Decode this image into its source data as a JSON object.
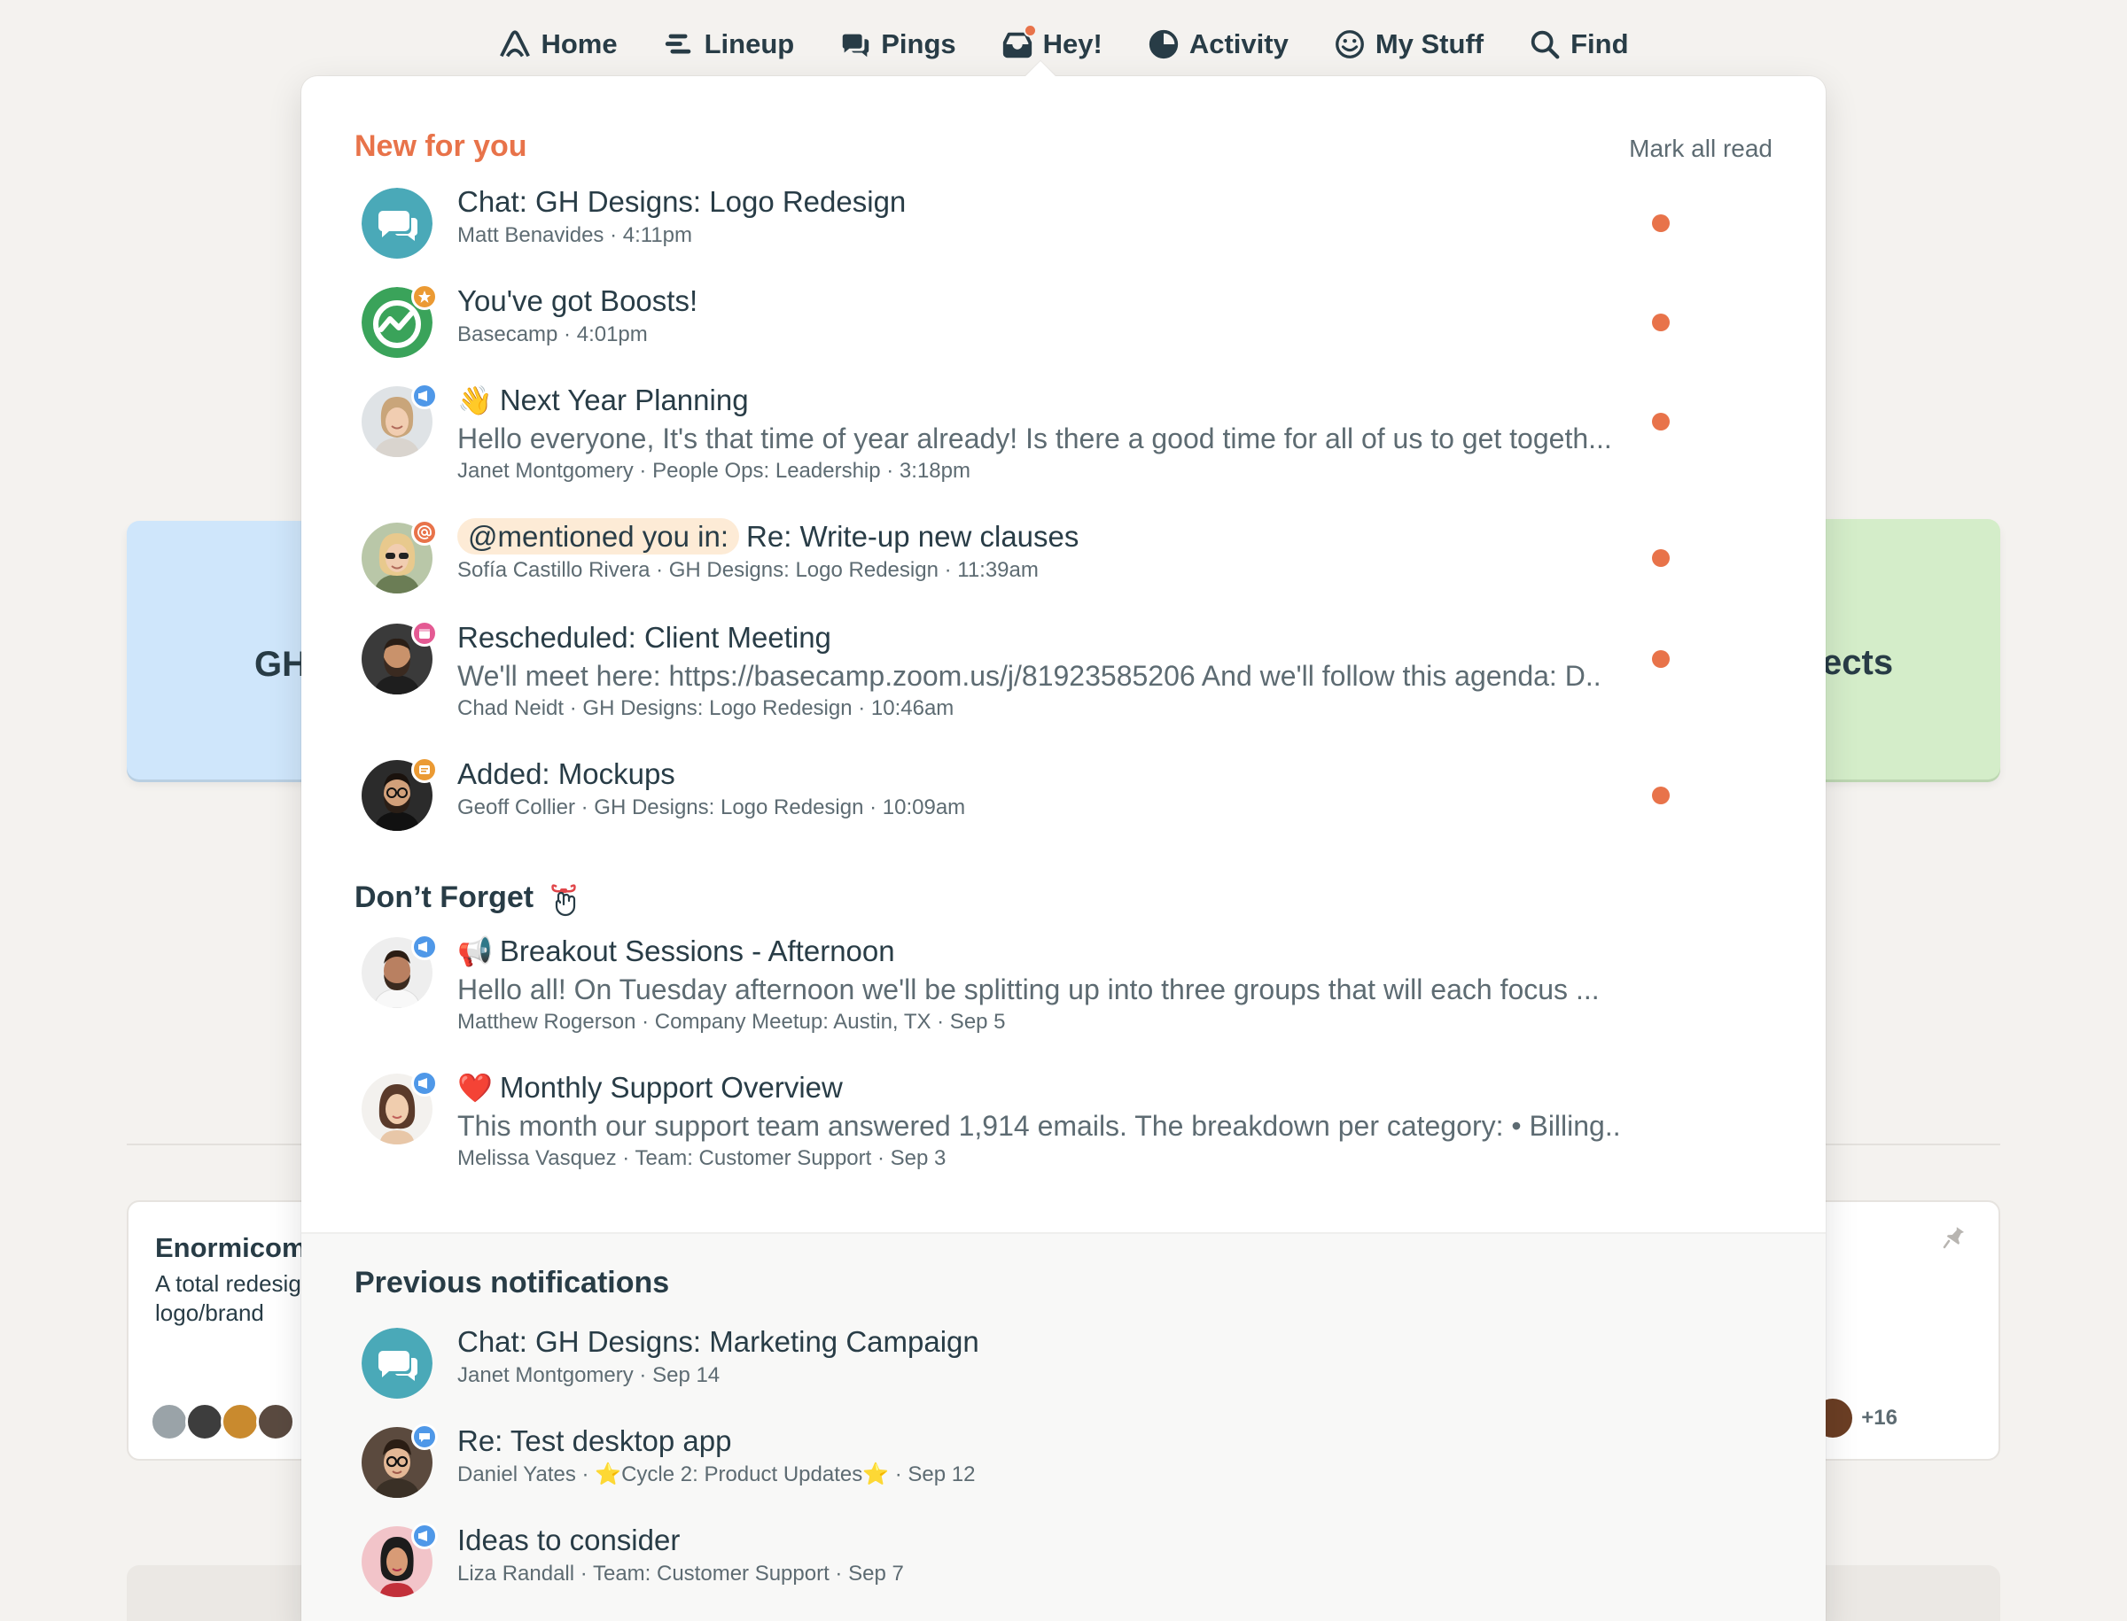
{
  "nav": [
    {
      "label": "Home",
      "icon": "home-icon"
    },
    {
      "label": "Lineup",
      "icon": "lineup-icon"
    },
    {
      "label": "Pings",
      "icon": "pings-icon"
    },
    {
      "label": "Hey!",
      "icon": "hey-icon"
    },
    {
      "label": "Activity",
      "icon": "activity-icon"
    },
    {
      "label": "My Stuff",
      "icon": "my-stuff-icon"
    },
    {
      "label": "Find",
      "icon": "search-icon"
    }
  ],
  "background": {
    "card_left_label": "GH",
    "card_right_label": "ects",
    "project_title": "Enormicom",
    "project_desc": "A total redesig logo/brand",
    "project_more": "+16"
  },
  "panel": {
    "new_heading": "New for you",
    "mark_all_read": "Mark all read",
    "new_items": [
      {
        "title": "Chat: GH Designs: Logo Redesign",
        "meta": "Matt Benavides · 4:11pm"
      },
      {
        "title": "You've got Boosts!",
        "meta": "Basecamp · 4:01pm"
      },
      {
        "emoji": "👋",
        "title": "Next Year Planning",
        "excerpt": "Hello everyone, It's that time of year already! Is there a good time for all of us to get togeth...",
        "meta": "Janet Montgomery · People Ops: Leadership · 3:18pm"
      },
      {
        "mention": "@mentioned you in:",
        "title": "Re: Write-up new clauses",
        "meta": "Sofía Castillo Rivera · GH Designs: Logo Redesign · 11:39am"
      },
      {
        "title": "Rescheduled: Client Meeting",
        "excerpt": "We'll meet here: https://basecamp.zoom.us/j/81923585206 And we'll follow this agenda: D..",
        "meta": "Chad Neidt · GH Designs: Logo Redesign · 10:46am"
      },
      {
        "title": "Added: Mockups",
        "meta": "Geoff Collier · GH Designs: Logo Redesign · 10:09am"
      }
    ],
    "forget_heading": "Don’t Forget",
    "forget_items": [
      {
        "emoji": "📢",
        "title": "Breakout Sessions - Afternoon",
        "excerpt": "Hello all! On Tuesday afternoon we'll be splitting up into three groups that will each focus ...",
        "meta": "Matthew Rogerson · Company Meetup: Austin, TX · Sep 5"
      },
      {
        "emoji": "❤️",
        "title": "Monthly Support Overview",
        "excerpt": "This month our support team answered 1,914 emails. The breakdown per category: • Billing..",
        "meta": "Melissa Vasquez · Team: Customer Support · Sep 3"
      }
    ],
    "previous_heading": "Previous notifications",
    "previous_items": [
      {
        "title": "Chat: GH Designs: Marketing Campaign",
        "meta": "Janet Montgomery · Sep 14"
      },
      {
        "title": "Re: Test desktop app",
        "meta": "Daniel Yates · ⭐Cycle 2: Product Updates⭐ · Sep 12"
      },
      {
        "title": "Ideas to consider",
        "meta": "Liza Randall · Team: Customer Support · Sep 7"
      }
    ]
  },
  "colors": {
    "accent": "#e8734a",
    "chat_teal": "#4aa9b8",
    "boost_green": "#3aa35a",
    "badge_blue": "#4f98e8",
    "badge_pink": "#e45a93",
    "badge_orange": "#eb9a33"
  }
}
